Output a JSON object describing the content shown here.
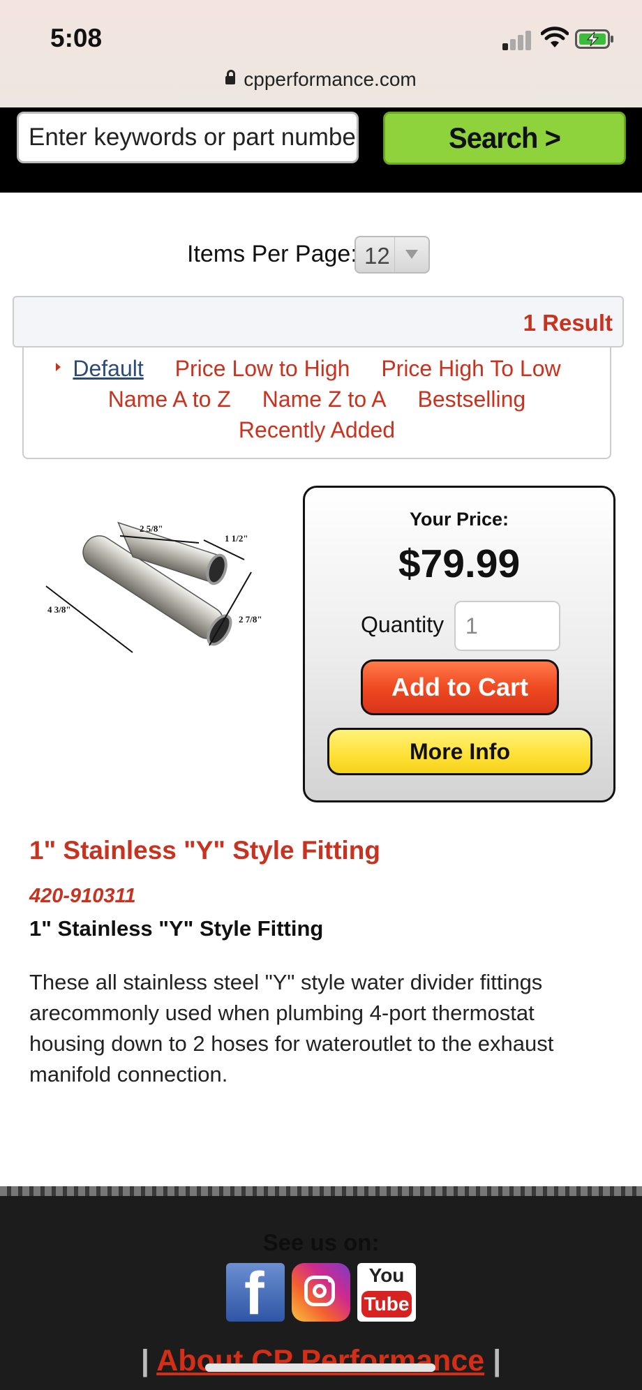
{
  "status_bar": {
    "time": "5:08",
    "url": "cpperformance.com"
  },
  "search": {
    "placeholder": "Enter keywords or part number",
    "button_label": "Search >"
  },
  "listing": {
    "items_per_page_label": "Items Per Page:",
    "items_per_page_value": "12",
    "results_count": "1 Result",
    "sort_options": [
      "Default",
      "Price Low to High",
      "Price High To Low",
      "Name A to Z",
      "Name Z to A",
      "Bestselling",
      "Recently Added"
    ]
  },
  "product": {
    "image_dims": {
      "top": "2 5/8\"",
      "right": "1 1/2\"",
      "left": "4 3/8\"",
      "bottom": "2 7/8\""
    },
    "price_label": "Your Price:",
    "price": "$79.99",
    "quantity_label": "Quantity",
    "quantity_value": "1",
    "add_to_cart_label": "Add to Cart",
    "more_info_label": "More Info",
    "title": "1\" Stainless \"Y\" Style Fitting",
    "sku": "420-910311",
    "subtitle": "1\" Stainless \"Y\" Style Fitting",
    "description": "These all stainless steel \"Y\" style water divider fittings arecommonly used when plumbing 4-port thermostat housing down to 2 hoses for wateroutlet to the exhaust manifold connection."
  },
  "footer": {
    "see_us_on": "See us on:",
    "social": [
      "facebook-icon",
      "instagram-icon",
      "youtube-icon"
    ],
    "youtube_top": "You",
    "youtube_bottom": "Tube",
    "facebook_glyph": "f",
    "about_link": "About CP Performance",
    "separator": "|"
  },
  "colors": {
    "accent_red": "#c8321e",
    "search_green": "#8fd33c",
    "cart_orange": "#f04a22",
    "info_yellow": "#ffe23a"
  }
}
